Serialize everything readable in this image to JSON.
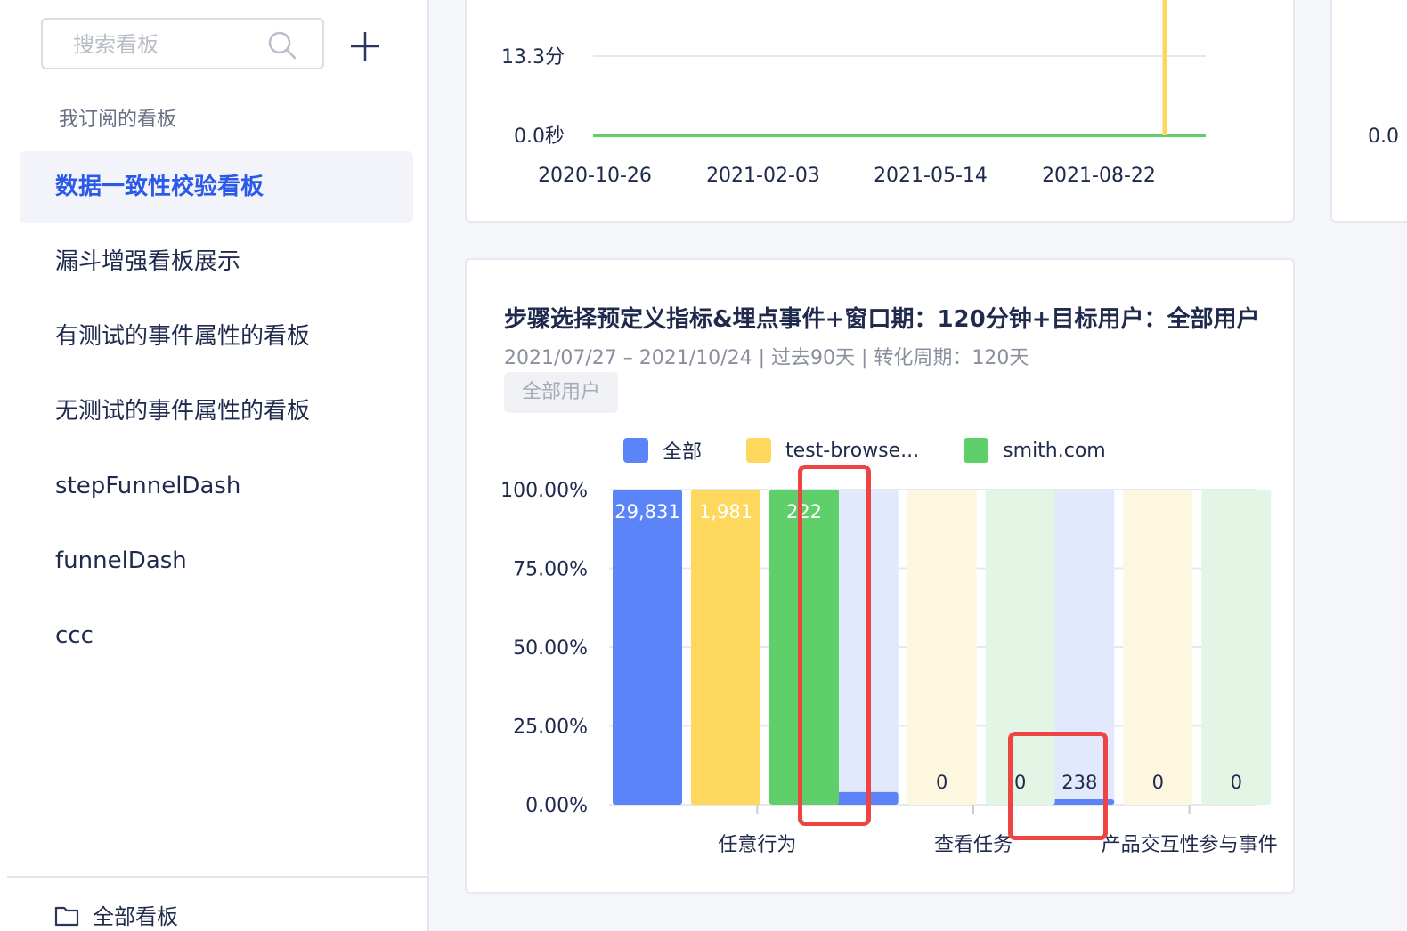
{
  "sidebar": {
    "search_placeholder": "搜索看板",
    "section_title": "我订阅的看板",
    "items": [
      {
        "label": "数据一致性校验看板",
        "active": true
      },
      {
        "label": "漏斗增强看板展示"
      },
      {
        "label": "有测试的事件属性的看板"
      },
      {
        "label": "无测试的事件属性的看板"
      },
      {
        "label": "stepFunnelDash"
      },
      {
        "label": "funnelDash"
      },
      {
        "label": "ccc"
      }
    ],
    "all_boards_label": "全部看板"
  },
  "top_card": {
    "y_ticks": [
      "13.3分",
      "0.0秒"
    ],
    "x_ticks": [
      "2020-10-26",
      "2021-02-03",
      "2021-05-14",
      "2021-08-22"
    ],
    "side_tick": "0.0"
  },
  "funnel_card": {
    "title": "步骤选择预定义指标&埋点事件+窗口期：120分钟+目标用户：全部用户",
    "subtitle": "2021/07/27 – 2021/10/24 | 过去90天 | 转化周期：120天",
    "tag": "全部用户",
    "legend": [
      {
        "label": "全部",
        "color": "#5b84f9"
      },
      {
        "label": "test-browse...",
        "color": "#fdd85d"
      },
      {
        "label": "smith.com",
        "color": "#5fcf6a"
      }
    ]
  },
  "chart_data": [
    {
      "type": "line",
      "x_ticks": [
        "2020-10-26",
        "2021-02-03",
        "2021-05-14",
        "2021-08-22"
      ],
      "y_ticks": [
        "0.0秒",
        "13.3分"
      ],
      "series": [
        {
          "color": "#5fcf6a",
          "values": [
            0,
            0,
            0,
            0
          ]
        },
        {
          "color": "#fdd85d",
          "spike_near": "2021-10"
        }
      ]
    },
    {
      "type": "bar",
      "categories": [
        "任意行为",
        "查看任务",
        "产品交互性参与事件"
      ],
      "y_ticks": [
        "100.00%",
        "75.00%",
        "50.00%",
        "25.00%",
        "0.00%"
      ],
      "ylim": [
        0,
        100
      ],
      "series": [
        {
          "name": "全部",
          "color": "#5b84f9",
          "values": [
            100,
            4,
            1
          ],
          "labels": [
            "29,831",
            "",
            "238"
          ]
        },
        {
          "name": "test-browse...",
          "color": "#fdd85d",
          "values": [
            100,
            0,
            0
          ],
          "labels": [
            "1,981",
            "0",
            "0"
          ]
        },
        {
          "name": "smith.com",
          "color": "#5fcf6a",
          "values": [
            100,
            0,
            0
          ],
          "labels": [
            "222",
            "0",
            "0"
          ]
        }
      ]
    }
  ]
}
